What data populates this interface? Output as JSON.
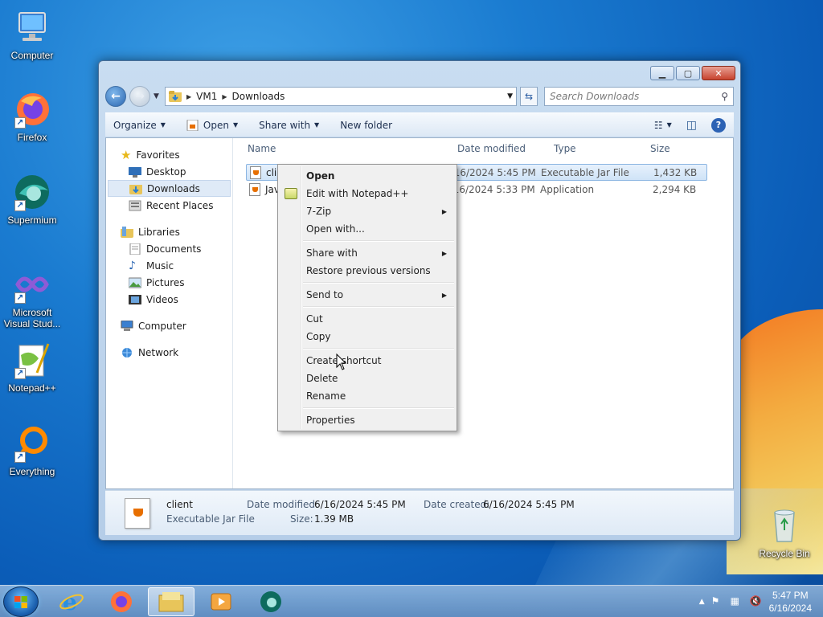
{
  "desktop": {
    "icons": [
      {
        "label": "Computer"
      },
      {
        "label": "Firefox"
      },
      {
        "label": "Supermium"
      },
      {
        "label": "Microsoft Visual Stud..."
      },
      {
        "label": "Notepad++"
      },
      {
        "label": "Everything"
      },
      {
        "label": "Recycle Bin"
      }
    ]
  },
  "window": {
    "breadcrumb": [
      "VM1",
      "Downloads"
    ],
    "search_placeholder": "Search Downloads",
    "toolbar": {
      "organize": "Organize",
      "open": "Open",
      "share_with": "Share with",
      "new_folder": "New folder"
    },
    "nav": {
      "favorites": "Favorites",
      "desktop": "Desktop",
      "downloads": "Downloads",
      "recent_places": "Recent Places",
      "libraries": "Libraries",
      "documents": "Documents",
      "music": "Music",
      "pictures": "Pictures",
      "videos": "Videos",
      "computer": "Computer",
      "network": "Network"
    },
    "columns": {
      "name": "Name",
      "date_modified": "Date modified",
      "type": "Type",
      "size": "Size"
    },
    "files": [
      {
        "name": "clie",
        "date": "6/16/2024 5:45 PM",
        "type": "Executable Jar File",
        "size": "1,432 KB",
        "selected": true
      },
      {
        "name": "Jav",
        "date": "6/16/2024 5:33 PM",
        "type": "Application",
        "size": "2,294 KB",
        "selected": false
      }
    ],
    "details": {
      "name": "client",
      "kind": "Executable Jar File",
      "date_modified_label": "Date modified:",
      "date_modified": "6/16/2024 5:45 PM",
      "size_label": "Size:",
      "size": "1.39 MB",
      "date_created_label": "Date created:",
      "date_created": "6/16/2024 5:45 PM"
    }
  },
  "context_menu": {
    "open": "Open",
    "edit_npp": "Edit with Notepad++",
    "seven_zip": "7-Zip",
    "open_with": "Open with...",
    "share_with": "Share with",
    "restore": "Restore previous versions",
    "send_to": "Send to",
    "cut": "Cut",
    "copy": "Copy",
    "create_shortcut": "Create shortcut",
    "delete": "Delete",
    "rename": "Rename",
    "properties": "Properties"
  },
  "taskbar": {
    "time": "5:47 PM",
    "date": "6/16/2024"
  }
}
